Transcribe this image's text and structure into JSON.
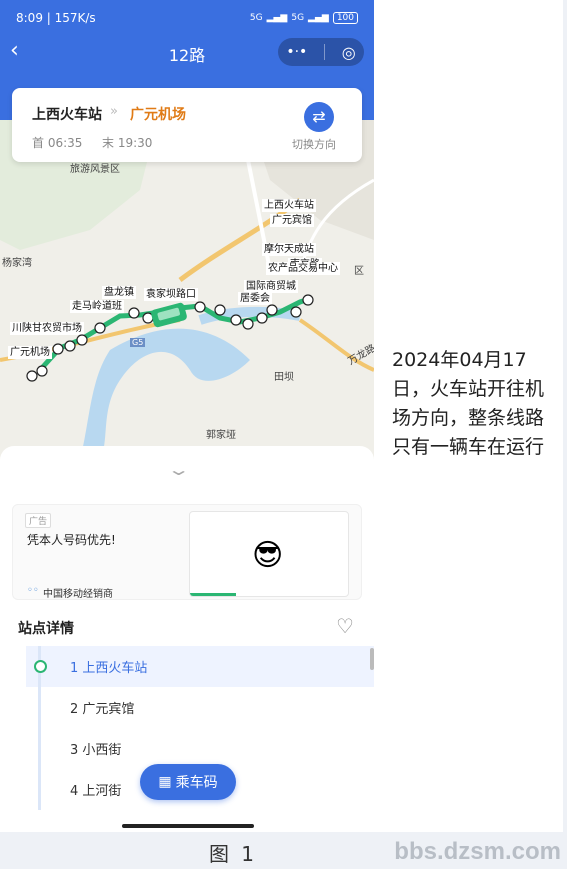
{
  "status_bar": {
    "time_speed": "8:09 | 157K/s",
    "signal_left": "5G",
    "signal_right": "5G",
    "battery": "100"
  },
  "nav": {
    "title": "12路"
  },
  "route": {
    "from": "上西火车站",
    "to": "广元机场",
    "first_bus": "首 06:35",
    "last_bus": "末 19:30",
    "switch_label": "切换方向"
  },
  "map": {
    "places": [
      "旅游风景区",
      "杨家湾",
      "田坝",
      "郭家垭",
      "万龙路",
      "G5",
      "区"
    ],
    "stops": [
      "上西火车站",
      "广元宾馆",
      "摩尔天成站",
      "南京路",
      "农产品交易中心",
      "国际商贸城",
      "居委会",
      "袁家坝路口",
      "盘龙镇",
      "走马岭道班",
      "川陕甘农贸市场",
      "广元机场"
    ]
  },
  "ad": {
    "tag": "广告",
    "text": "凭本人号码优先!",
    "brand": "中国移动经销商"
  },
  "stops_section": {
    "title": "站点详情",
    "items": [
      {
        "label": "1 上西火车站"
      },
      {
        "label": "2 广元宾馆"
      },
      {
        "label": "3 小西街"
      },
      {
        "label": "4 上河街"
      }
    ]
  },
  "ride_button": {
    "label": "乘车码"
  },
  "side_note": "2024年04月17日，火车站开往机场方向，整条线路只有一辆车在运行",
  "caption": "图 1",
  "watermark": "bbs.dzsm.com",
  "colors": {
    "primary": "#3a6fe0",
    "accent_orange": "#e07b16",
    "route_green": "#2bb673"
  }
}
